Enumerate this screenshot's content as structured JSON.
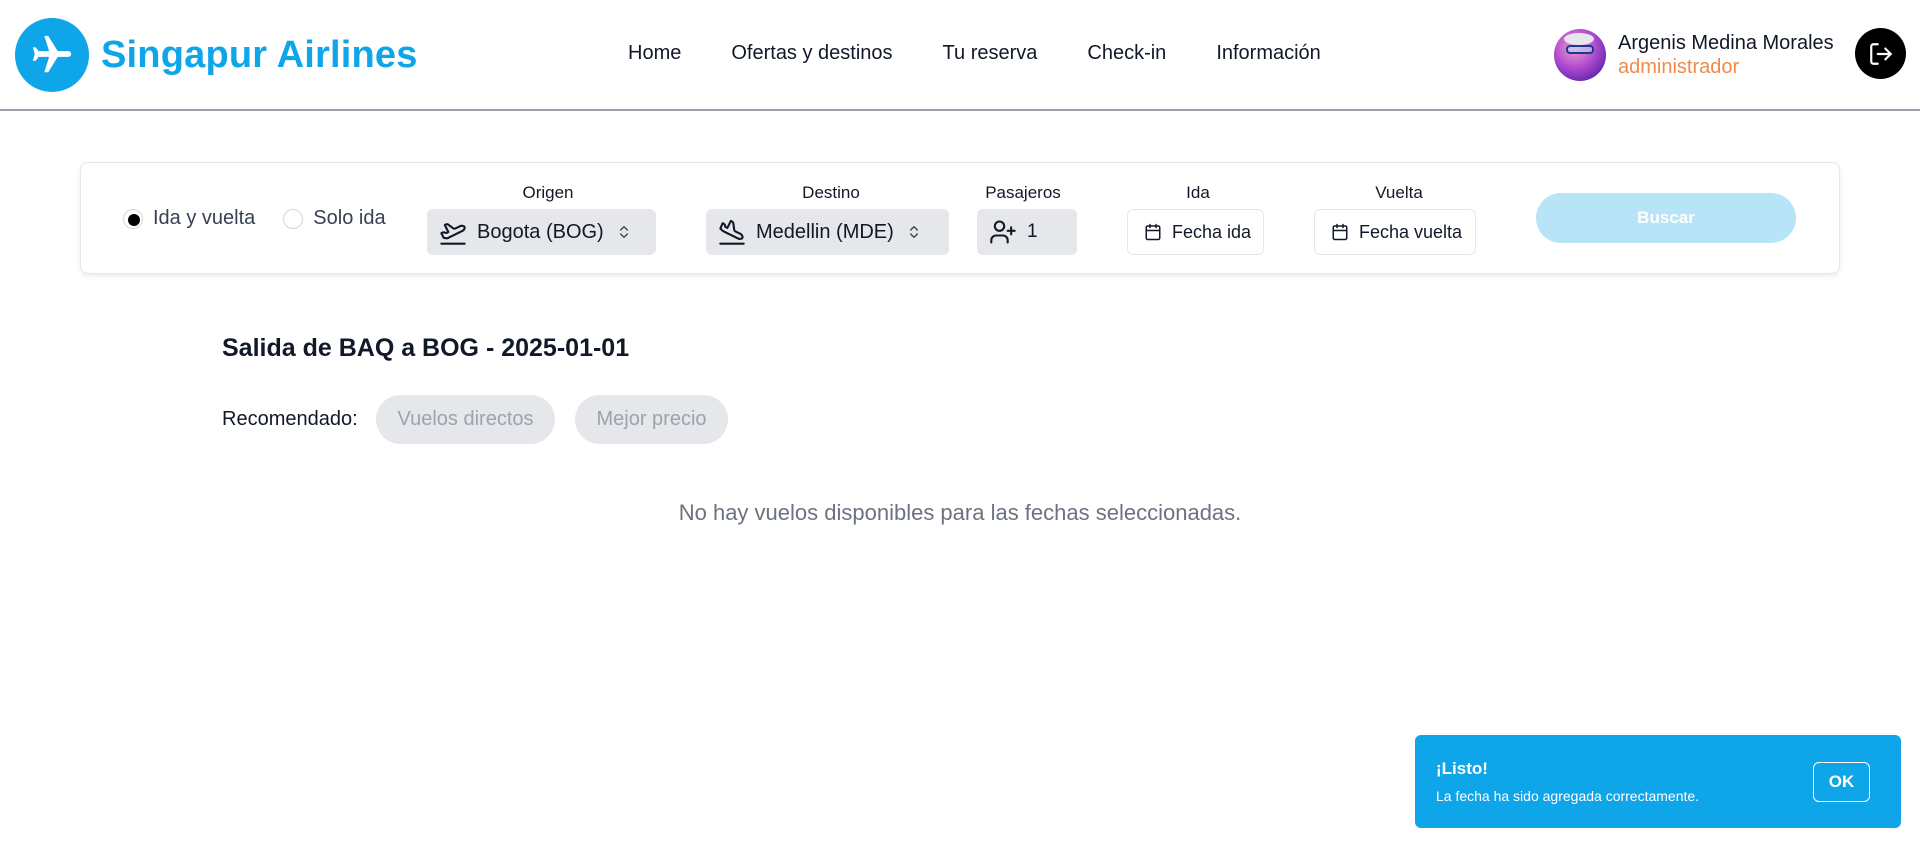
{
  "brand": {
    "name": "Singapur Airlines",
    "logo_icon": "airplane-icon",
    "color": "#0ea5e9"
  },
  "nav": {
    "items": [
      {
        "label": "Home"
      },
      {
        "label": "Ofertas y destinos"
      },
      {
        "label": "Tu reserva"
      },
      {
        "label": "Check-in"
      },
      {
        "label": "Información"
      }
    ]
  },
  "user": {
    "name": "Argenis Medina Morales",
    "role": "administrador",
    "logout_icon": "logout-icon"
  },
  "search": {
    "trip_types": [
      {
        "label": "Ida y vuelta",
        "selected": true
      },
      {
        "label": "Solo ida",
        "selected": false
      }
    ],
    "origin": {
      "label": "Origen",
      "value": "Bogota (BOG)",
      "icon": "plane-takeoff-icon"
    },
    "destination": {
      "label": "Destino",
      "value": "Medellin (MDE)",
      "icon": "plane-landing-icon"
    },
    "passengers": {
      "label": "Pasajeros",
      "value": "1",
      "icon": "user-plus-icon"
    },
    "departure": {
      "label": "Ida",
      "value": "Fecha ida",
      "icon": "calendar-icon"
    },
    "return": {
      "label": "Vuelta",
      "value": "Fecha vuelta",
      "icon": "calendar-icon"
    },
    "submit_label": "Buscar"
  },
  "results": {
    "title": "Salida de BAQ a BOG - 2025-01-01",
    "recommended_label": "Recomendado:",
    "filters": [
      {
        "label": "Vuelos directos"
      },
      {
        "label": "Mejor precio"
      }
    ],
    "empty_message": "No hay vuelos disponibles para las fechas seleccionadas."
  },
  "toast": {
    "title": "¡Listo!",
    "message": "La fecha ha sido agregada correctamente.",
    "ok_label": "OK"
  }
}
